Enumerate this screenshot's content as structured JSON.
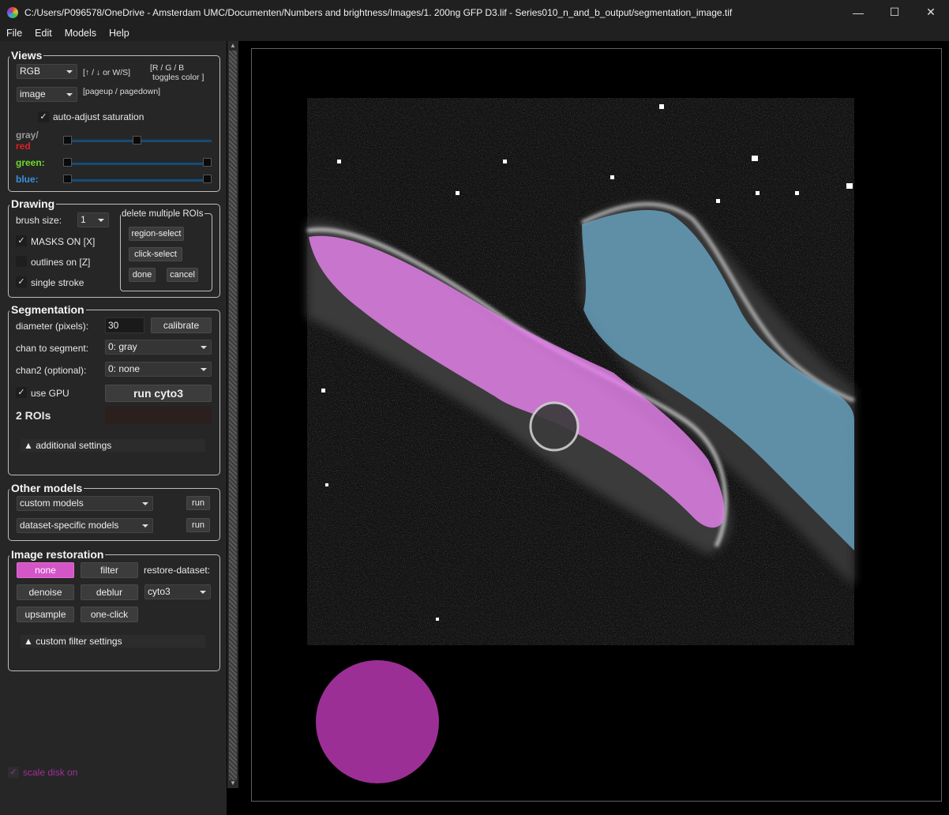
{
  "window": {
    "title": "C:/Users/P096578/OneDrive - Amsterdam UMC/Documenten/Numbers and brightness/Images/1. 200ng GFP D3.lif - Series010_n_and_b_output/segmentation_image.tif",
    "minimize": "—",
    "maximize": "☐",
    "close": "✕"
  },
  "menu": [
    "File",
    "Edit",
    "Models",
    "Help"
  ],
  "views": {
    "title": "Views",
    "color_mode": "RGB",
    "hint_keys": "[↑ / ↓ or W/S]",
    "hint_toggle_1": "[R / G / B",
    "hint_toggle_2": "toggles color ]",
    "view_mode": "image",
    "hint_page": "[pageup / pagedown]",
    "auto_adjust_label": "auto-adjust saturation",
    "auto_adjust_checked": true,
    "gray_label": "gray/",
    "red_label": "red",
    "green_label": "green:",
    "blue_label": "blue:",
    "colors": {
      "gray": "#9a9a9a",
      "red": "#e02020",
      "green": "#6ddc2c",
      "blue": "#3a8fe0"
    }
  },
  "drawing": {
    "title": "Drawing",
    "brush_label": "brush size:",
    "brush_value": "1",
    "masks_label": "MASKS ON [X]",
    "masks_checked": true,
    "outlines_label": "outlines on [Z]",
    "outlines_checked": false,
    "single_label": "single stroke",
    "single_checked": true,
    "delete_title": "delete multiple ROIs",
    "region_select": "region-select",
    "click_select": "click-select",
    "done": "done",
    "cancel": "cancel"
  },
  "segmentation": {
    "title": "Segmentation",
    "diameter_label": "diameter (pixels):",
    "diameter_value": "30",
    "calibrate": "calibrate",
    "chan_label": "chan to segment:",
    "chan_value": "0: gray",
    "chan2_label": "chan2 (optional):",
    "chan2_value": "0: none",
    "gpu_label": "use GPU",
    "gpu_checked": true,
    "run_label": "run cyto3",
    "rois_label": "2 ROIs",
    "additional_settings": "▲ additional settings"
  },
  "other_models": {
    "title": "Other models",
    "custom_models": "custom models",
    "dataset_models": "dataset-specific models",
    "run1": "run",
    "run2": "run"
  },
  "restoration": {
    "title": "Image restoration",
    "none": "none",
    "filter": "filter",
    "restore_label": "restore-dataset:",
    "denoise": "denoise",
    "deblur": "deblur",
    "dataset_value": "cyto3",
    "upsample": "upsample",
    "one_click": "one-click",
    "custom_filter": "▲ custom filter settings"
  },
  "scale_disk": {
    "label": "scale disk on",
    "checked": true,
    "color": "#a0309a"
  },
  "masks": {
    "roi1_color": "#e080e8",
    "roi2_color": "#6aa6c4",
    "disk_color": "#9c2f96"
  }
}
